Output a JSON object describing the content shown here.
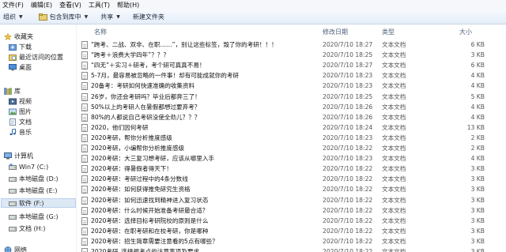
{
  "menu": [
    "文件(F)",
    "编辑(E)",
    "查看(V)",
    "工具(T)",
    "帮助(H)"
  ],
  "toolbar": {
    "organize": "组织",
    "include_in_library": "包含到库中",
    "share": "共享",
    "new_folder": "新建文件夹"
  },
  "sidebar": {
    "favorites": "收藏夹",
    "favorites_items": [
      "下载",
      "最近访问的位置",
      "桌面"
    ],
    "libraries": "库",
    "library_items": [
      "视频",
      "图片",
      "文档",
      "音乐"
    ],
    "computer": "计算机",
    "drives": [
      "Win7 (C:)",
      "本地磁盘 (D:)",
      "本地磁盘 (E:)",
      "软件 (F:)",
      "本地磁盘 (G:)",
      "文档 (H:)"
    ],
    "selected_drive": "软件 (F:)",
    "network": "网络"
  },
  "columns": {
    "name": "名称",
    "date": "修改日期",
    "type": "类型",
    "size": "大小"
  },
  "files": [
    {
      "name": "“跨考、二战、双非、在职……”，别让这些标签，毁了你的考研！！！",
      "date": "2020/7/10 18:27",
      "type": "文本文档",
      "size": "6 KB"
    },
    {
      "name": "“跨考＋浪费大学四年”？？？",
      "date": "2020/7/10 18:25",
      "type": "文本文档",
      "size": "3 KB"
    },
    {
      "name": "“四无”＋实习＋研考，考个研可真真不易！",
      "date": "2020/7/10 18:27",
      "type": "文本文档",
      "size": "6 KB"
    },
    {
      "name": "5-7月，最容易被忽略的一件事！却有可能成就你的考研",
      "date": "2020/7/10 18:23",
      "type": "文本文档",
      "size": "4 KB"
    },
    {
      "name": "20备考：考研如何快速准确的收集资料",
      "date": "2020/7/10 18:23",
      "type": "文本文档",
      "size": "4 KB"
    },
    {
      "name": "26岁，你还会考研吗？毕业后都奔三了！",
      "date": "2020/7/10 18:25",
      "type": "文本文档",
      "size": "5 KB"
    },
    {
      "name": "50%以上的考研人在暑假都想过要弃考？",
      "date": "2020/7/10 18:26",
      "type": "文本文档",
      "size": "4 KB"
    },
    {
      "name": "80%的人都说自己考研没使全劲儿？？？",
      "date": "2020/7/10 18:26",
      "type": "文本文档",
      "size": "4 KB"
    },
    {
      "name": "2020，他们因何考研",
      "date": "2020/7/10 18:24",
      "type": "文本文档",
      "size": "13 KB"
    },
    {
      "name": "2020考研，帮你分析推度感级",
      "date": "2020/7/10 18:23",
      "type": "文本文档",
      "size": "2 KB"
    },
    {
      "name": "2020考研，小编帮你分析推度感级",
      "date": "2020/7/10 18:22",
      "type": "文本文档",
      "size": "2 KB"
    },
    {
      "name": "2020考研：大三复习想考研，应该从哪里入手",
      "date": "2020/7/10 18:23",
      "type": "文本文档",
      "size": "4 KB"
    },
    {
      "name": "2020考研：得暑假者得天下！",
      "date": "2020/7/10 18:22",
      "type": "文本文档",
      "size": "3 KB"
    },
    {
      "name": "2020考研：考研过程中的4条分数线",
      "date": "2020/7/10 18:22",
      "type": "文本文档",
      "size": "3 KB"
    },
    {
      "name": "2020考研：如何获得推免研究生资格",
      "date": "2020/7/10 18:22",
      "type": "文本文档",
      "size": "3 KB"
    },
    {
      "name": "2020考研：如何迅速找到精神进入复习状态",
      "date": "2020/7/10 18:22",
      "type": "文本文档",
      "size": "3 KB"
    },
    {
      "name": "2020考研：什么时候开始准备考研最合适？",
      "date": "2020/7/10 18:22",
      "type": "文本文档",
      "size": "3 KB"
    },
    {
      "name": "2020考研：选择目标考研院校的原则是什么",
      "date": "2020/7/10 18:22",
      "type": "文本文档",
      "size": "3 KB"
    },
    {
      "name": "2020考研：在职考研和在校考研，你是哪种",
      "date": "2020/7/10 18:22",
      "type": "文本文档",
      "size": "3 KB"
    },
    {
      "name": "2020考研：招生简章需要注意看的5点有哪些？",
      "date": "2020/7/10 18:22",
      "type": "文本文档",
      "size": "3 KB"
    },
    {
      "name": "2020考研_选择报考点的注意事项及要求",
      "date": "2020/7/10 18:22",
      "type": "文本文档",
      "size": "3 KB"
    }
  ]
}
